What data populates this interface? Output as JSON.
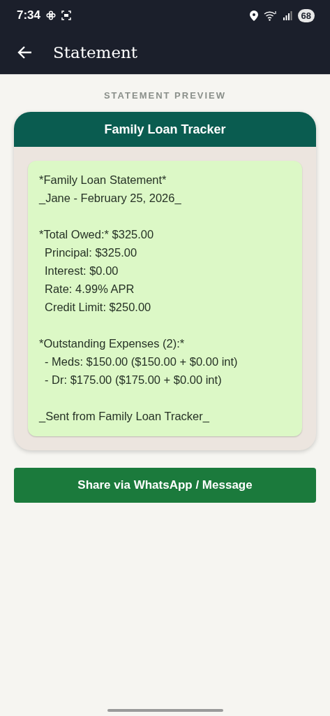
{
  "status_bar": {
    "time": "7:34",
    "battery": "68"
  },
  "app_bar": {
    "title": "Statement"
  },
  "section_label": "STATEMENT PREVIEW",
  "card": {
    "header": "Family Loan Tracker",
    "paragraphs": [
      {
        "lines": [
          {
            "text": "*Family Loan Statement*",
            "indented": false
          },
          {
            "text": "_Jane - February 25, 2026_",
            "indented": false
          }
        ]
      },
      {
        "lines": [
          {
            "text": "*Total Owed:* $325.00",
            "indented": false
          },
          {
            "text": "Principal: $325.00",
            "indented": true
          },
          {
            "text": "Interest: $0.00",
            "indented": true
          },
          {
            "text": "Rate: 4.99% APR",
            "indented": true
          },
          {
            "text": "Credit Limit: $250.00",
            "indented": true
          }
        ]
      },
      {
        "lines": [
          {
            "text": "*Outstanding Expenses (2):*",
            "indented": false
          },
          {
            "text": "- Meds: $150.00 ($150.00 + $0.00 int)",
            "indented": true
          },
          {
            "text": "- Dr: $175.00 ($175.00 + $0.00 int)",
            "indented": true
          }
        ]
      },
      {
        "lines": [
          {
            "text": "_Sent from Family Loan Tracker_",
            "indented": false
          }
        ]
      }
    ]
  },
  "share_button": "Share via WhatsApp / Message"
}
